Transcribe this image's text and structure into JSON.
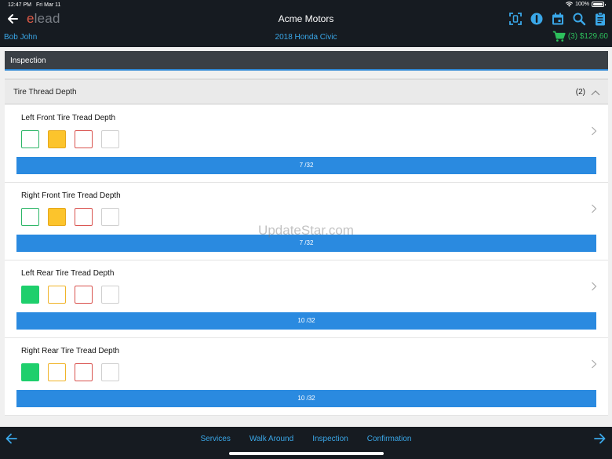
{
  "status": {
    "time": "12:47 PM",
    "date": "Fri Mar 11",
    "battery": "100%"
  },
  "header": {
    "logo_e": "e",
    "logo_rest": "lead",
    "title": "Acme Motors",
    "customer": "Bob John",
    "vehicle": "2018 Honda Civic",
    "cart": "(3) $129.60",
    "icons": [
      "back-arrow",
      "scan-icon",
      "info-icon",
      "calendar-icon",
      "search-icon",
      "clipboard-icon",
      "cart-icon"
    ]
  },
  "section": {
    "title": "Inspection"
  },
  "group": {
    "title": "Tire Thread Depth",
    "count": "(2)"
  },
  "items": [
    {
      "title": "Left Front Tire Tread Depth",
      "selected": "yellow",
      "depth": "7 /32"
    },
    {
      "title": "Right Front Tire Tread Depth",
      "selected": "yellow",
      "depth": "7 /32"
    },
    {
      "title": "Left Rear Tire Tread Depth",
      "selected": "green",
      "depth": "10 /32"
    },
    {
      "title": "Right Rear Tire Tread Depth",
      "selected": "green",
      "depth": "10 /32"
    }
  ],
  "watermark": "UpdateStar.com",
  "footer": {
    "tabs": [
      "Services",
      "Walk Around",
      "Inspection",
      "Confirmation"
    ]
  },
  "colors": {
    "accent": "#2a8ae0",
    "link": "#3aa7e8",
    "green": "#1ecf6c",
    "yellow": "#fcc42c",
    "red": "#d9534f",
    "dark": "#161b21"
  }
}
